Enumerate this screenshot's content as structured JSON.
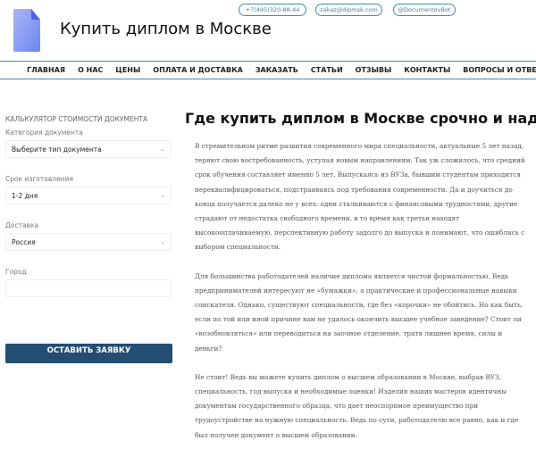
{
  "header": {
    "title": "Купить диплом в Москве",
    "phone": "+7(495)320-88-44",
    "email": "zakaz@dipmsk.com",
    "telegram": "@DocumentovBot"
  },
  "nav": {
    "items": [
      "ГЛАВНАЯ",
      "О НАС",
      "ЦЕНЫ",
      "ОПЛАТА И ДОСТАВКА",
      "ЗАКАЗАТЬ",
      "СТАТЬИ",
      "ОТЗЫВЫ",
      "КОНТАКТЫ",
      "ВОПРОСЫ И ОТВЕТЫ"
    ],
    "search_icon": "search-icon"
  },
  "calculator": {
    "heading": "КАЛЬКУЛЯТОР СТОИМОСТИ ДОКУМЕНТА",
    "category_label": "Категория документа",
    "category_value": "Выберите тип документа",
    "term_label": "Срок изготовления",
    "term_value": "1-2 дня",
    "delivery_label": "Доставка",
    "delivery_value": "Россия",
    "city_label": "Город",
    "city_value": "",
    "submit": "ОСТАВИТЬ ЗАЯВКУ"
  },
  "article": {
    "title": "Где купить диплом в Москве срочно и надеж",
    "paragraphs": [
      "В стремительном ритме развития современного мира специальности, актуальные 5 лет назад, теряют свою востребованность, уступая новым направлениям. Так уж сложилось, что средний срок обучения составляет именно 5 лет. Выпускаясь из ВУЗа, бывшим студентам приходится переквалифицироваться, подстраиваясь под требования современности. Да и доучиться до конца получается далеко не у всех: одни сталкиваются с финансовыми трудностями, другие страдают от недостатка свободного времени, в то время как третьи находят высокооплачиваемую, перспективную работу задолго до выпуска и понимают, что ошиблись с выбором специальности.",
      "Для большинства работодателей наличие диплома является чистой формальностью. Ведь предпринимателей интересуют не «бумажки», а практические и профессиональные навыки соискателя. Однако, существуют специальности, где без «корочки» не обойтись. Но как быть, если по той или иной причине вам не удалось окончить высшее учебное заведение? Стоит ли «возобновляться» или переводиться на заочное отделение, тратя лишнее время, силы и деньги?",
      "Не стоит! Ведь вы можете купить диплом о высшем образовании в Москве, выбрав ВУЗ, специальность, год выпуска и необходимые оценки! Изделия наших мастеров идентичны документам государственного образца, что дает неоспоримое преимущество при трудоустройстве на нужную специальность. Ведь по сути, работодателю все равно, как и где был получен документ о высшем образовании."
    ]
  }
}
